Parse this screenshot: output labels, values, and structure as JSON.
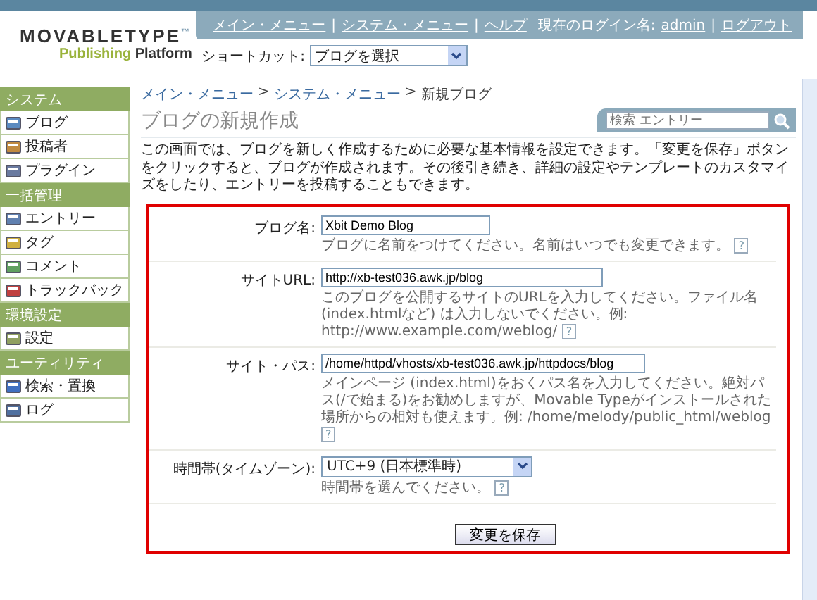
{
  "header": {
    "logo": {
      "title": "MOVABLETYPE",
      "trademark": "™",
      "subtitle_1": "Publishing",
      "subtitle_2": "Platform"
    },
    "nav_links": [
      "メイン・メニュー",
      "システム・メニュー",
      "ヘルプ"
    ],
    "separator": "|",
    "login_label": "現在のログイン名:",
    "login_user": "admin",
    "logout": "ログアウト",
    "shortcut": {
      "label": "ショートカット:",
      "value": "ブログを選択"
    }
  },
  "sidebar": [
    {
      "title": "システム",
      "items": [
        "ブログ",
        "投稿者",
        "プラグイン"
      ]
    },
    {
      "title": "一括管理",
      "items": [
        "エントリー",
        "タグ",
        "コメント",
        "トラックバック"
      ]
    },
    {
      "title": "環境設定",
      "items": [
        "設定"
      ]
    },
    {
      "title": "ユーティリティ",
      "items": [
        "検索・置換",
        "ログ"
      ]
    }
  ],
  "breadcrumb": {
    "links": [
      "メイン・メニュー",
      "システム・メニュー"
    ],
    "current": "新規ブログ",
    "separator": ">"
  },
  "search": {
    "placeholder": "検索 エントリー"
  },
  "page_title": "ブログの新規作成",
  "description": "この画面では、ブログを新しく作成するために必要な基本情報を設定できます。「変更を保存」ボタンをクリックすると、ブログが作成されます。その後引き続き、詳細の設定やテンプレートのカスタマイズをしたり、エントリーを投稿することもできます。",
  "form": {
    "fields": [
      {
        "kind": "text",
        "label": "ブログ名:",
        "value": "Xbit Demo Blog",
        "hint": "ブログに名前をつけてください。名前はいつでも変更できます。",
        "help": "?"
      },
      {
        "kind": "text",
        "label": "サイトURL:",
        "value": "http://xb-test036.awk.jp/blog",
        "hint": "このブログを公開するサイトのURLを入力してください。ファイル名 (index.htmlなど) は入力しないでください。例: http://www.example.com/weblog/",
        "help": "?"
      },
      {
        "kind": "text",
        "label": "サイト・パス:",
        "value": "/home/httpd/vhosts/xb-test036.awk.jp/httpdocs/blog",
        "hint": "メインページ (index.html)をおくパス名を入力してください。絶対パス(/で始まる)をお勧めしますが、Movable Typeがインストールされた場所からの相対も使えます。例: /home/melody/public_html/weblog",
        "help": "?"
      },
      {
        "kind": "select",
        "label": "時間帯(タイムゾーン):",
        "value": "UTC+9 (日本標準時)",
        "hint": "時間帯を選んでください。",
        "help": "?"
      }
    ],
    "submit": "変更を保存"
  }
}
